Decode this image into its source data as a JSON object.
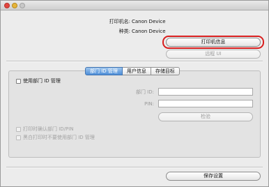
{
  "printer": {
    "name_label": "打印机名:",
    "name_value": "Canon Device",
    "type_label": "种类:",
    "type_value": "Canon Device"
  },
  "buttons": {
    "printer_info": "打印机信息",
    "remote_ui": "远程 UI",
    "verify": "检验",
    "save_settings": "保存设置"
  },
  "tabs": [
    {
      "label": "部门 ID 管理",
      "active": true
    },
    {
      "label": "用户信息",
      "active": false
    },
    {
      "label": "存储目标",
      "active": false
    }
  ],
  "department": {
    "use_label": "使用部门 ID 管理",
    "id_label": "部门 ID:",
    "id_value": "",
    "pin_label": "PIN:",
    "pin_value": "",
    "confirm_on_print": "打印时确认部门 ID/PIN",
    "allow_bw_without_id": "黑白打印时不要使用部门 ID 管理"
  },
  "colors": {
    "highlight": "#d81e1e",
    "active_tab": "#4d8ed8"
  }
}
